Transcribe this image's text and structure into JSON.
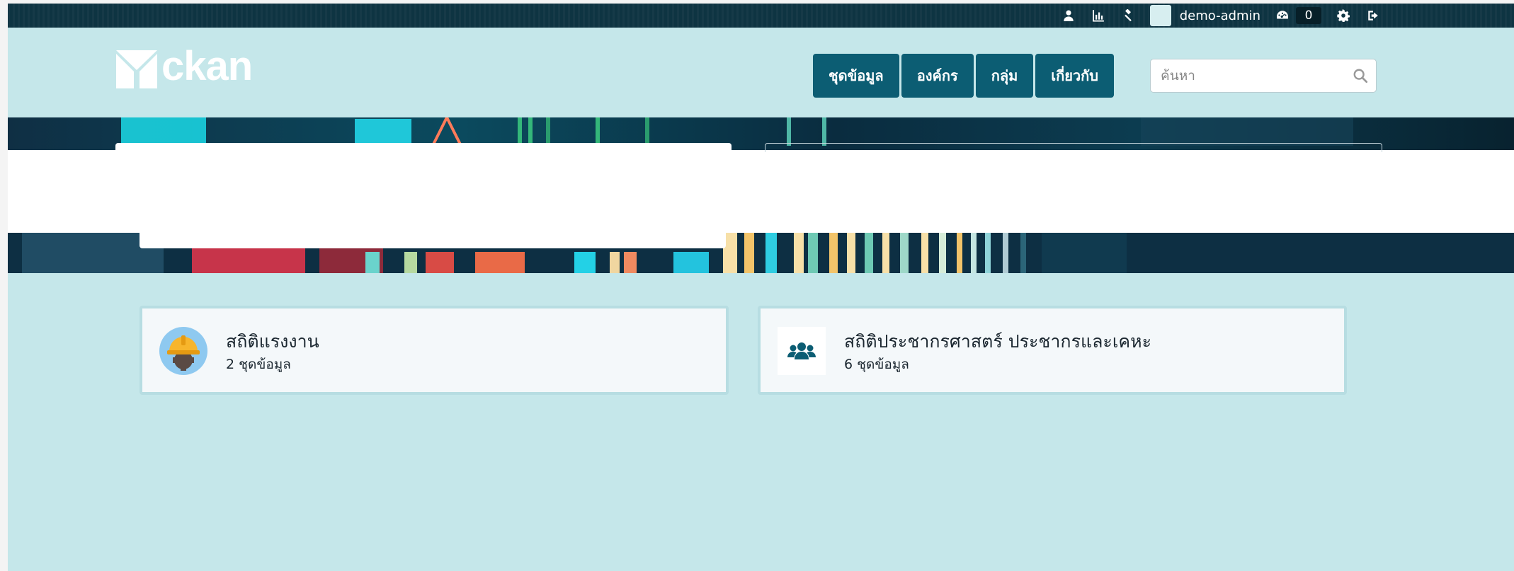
{
  "account": {
    "username": "demo-admin",
    "dashboard_count": "0",
    "icons": [
      "user-icon",
      "bar-chart-icon",
      "gavel-icon",
      "dashboard-icon",
      "gear-icon",
      "sign-out-icon"
    ]
  },
  "header": {
    "logo_text": "ckan",
    "nav": [
      "ชุดข้อมูล",
      "องค์กร",
      "กลุ่ม",
      "เกี่ยวกับ"
    ],
    "search_placeholder": "ค้นหา"
  },
  "groups": [
    {
      "title": "สถิติแรงงาน",
      "count": "2 ชุดข้อมูล",
      "icon": "worker-helmet-icon"
    },
    {
      "title": "สถิติประชากรศาสตร์ ประชากรและเคหะ",
      "count": "6 ชุดข้อมูล",
      "icon": "users-icon"
    }
  ],
  "colors": {
    "background": "#c5e7ea",
    "account_bar": "#0e3442",
    "nav_button": "#0c5d73",
    "icon_accent": "#0c5d73"
  }
}
